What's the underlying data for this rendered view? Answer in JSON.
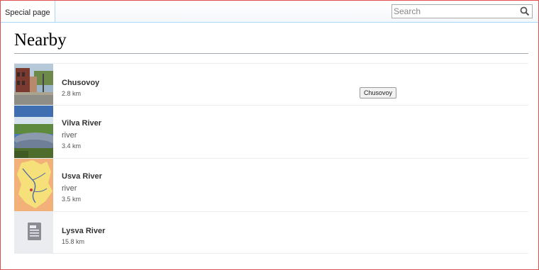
{
  "tabs": {
    "special": "Special page"
  },
  "search": {
    "placeholder": "Search"
  },
  "page": {
    "title": "Nearby"
  },
  "items": [
    {
      "title": "Chusovoy",
      "description": "",
      "distance": "2.8 km"
    },
    {
      "title": "Vilva River",
      "description": "river",
      "distance": "3.4 km"
    },
    {
      "title": "Usva River",
      "description": "river",
      "distance": "3.5 km"
    },
    {
      "title": "Lysva River",
      "description": "",
      "distance": "15.8 km"
    }
  ],
  "tooltip": {
    "text": "Chusovoy"
  },
  "icons": {
    "search": "magnifier-icon",
    "placeholder": "article-placeholder-icon"
  },
  "colors": {
    "frame_border": "#e05050",
    "header_rule": "#a2a9b1",
    "placeholder_bg": "#eaecf0"
  }
}
